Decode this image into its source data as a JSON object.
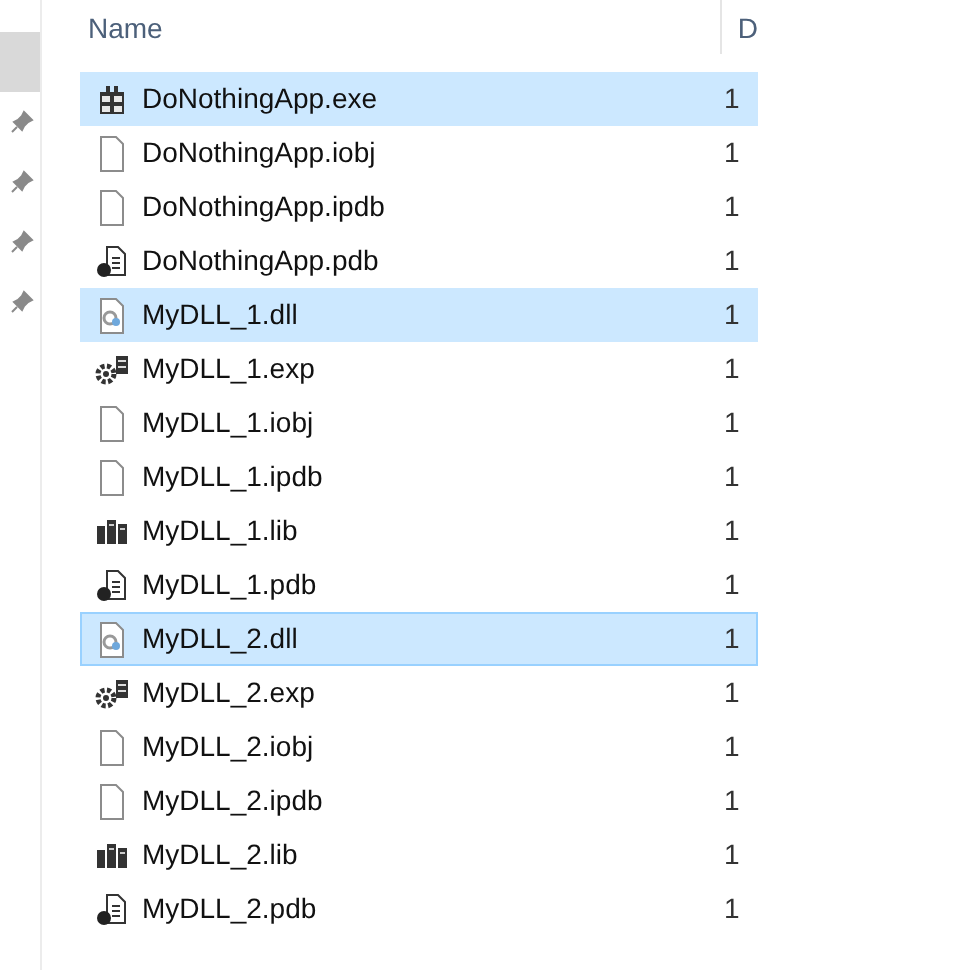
{
  "nav_items": [
    {
      "selected": true,
      "pinned": false
    },
    {
      "selected": false,
      "pinned": true
    },
    {
      "selected": false,
      "pinned": true
    },
    {
      "selected": false,
      "pinned": true
    },
    {
      "selected": false,
      "pinned": true
    }
  ],
  "columns": [
    "Name",
    "D"
  ],
  "rows": [
    {
      "name": "DoNothingApp.exe",
      "column_2": "1",
      "kind": "exe",
      "selected": true,
      "focused": false
    },
    {
      "name": "DoNothingApp.iobj",
      "column_2": "1",
      "kind": "file",
      "selected": false,
      "focused": false
    },
    {
      "name": "DoNothingApp.ipdb",
      "column_2": "1",
      "kind": "file",
      "selected": false,
      "focused": false
    },
    {
      "name": "DoNothingApp.pdb",
      "column_2": "1",
      "kind": "pdb",
      "selected": false,
      "focused": false
    },
    {
      "name": "MyDLL_1.dll",
      "column_2": "1",
      "kind": "dll",
      "selected": true,
      "focused": false
    },
    {
      "name": "MyDLL_1.exp",
      "column_2": "1",
      "kind": "exp",
      "selected": false,
      "focused": false
    },
    {
      "name": "MyDLL_1.iobj",
      "column_2": "1",
      "kind": "file",
      "selected": false,
      "focused": false
    },
    {
      "name": "MyDLL_1.ipdb",
      "column_2": "1",
      "kind": "file",
      "selected": false,
      "focused": false
    },
    {
      "name": "MyDLL_1.lib",
      "column_2": "1",
      "kind": "lib",
      "selected": false,
      "focused": false
    },
    {
      "name": "MyDLL_1.pdb",
      "column_2": "1",
      "kind": "pdb",
      "selected": false,
      "focused": false
    },
    {
      "name": "MyDLL_2.dll",
      "column_2": "1",
      "kind": "dll",
      "selected": true,
      "focused": true
    },
    {
      "name": "MyDLL_2.exp",
      "column_2": "1",
      "kind": "exp",
      "selected": false,
      "focused": false
    },
    {
      "name": "MyDLL_2.iobj",
      "column_2": "1",
      "kind": "file",
      "selected": false,
      "focused": false
    },
    {
      "name": "MyDLL_2.ipdb",
      "column_2": "1",
      "kind": "file",
      "selected": false,
      "focused": false
    },
    {
      "name": "MyDLL_2.lib",
      "column_2": "1",
      "kind": "lib",
      "selected": false,
      "focused": false
    },
    {
      "name": "MyDLL_2.pdb",
      "column_2": "1",
      "kind": "pdb",
      "selected": false,
      "focused": false
    }
  ]
}
